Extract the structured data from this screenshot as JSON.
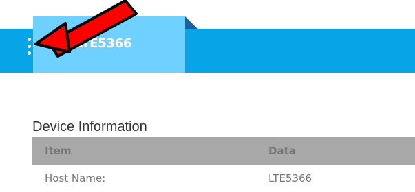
{
  "header": {
    "device_name": "LTE5366"
  },
  "section": {
    "title": "Device Information"
  },
  "table": {
    "columns": [
      "Item",
      "Data"
    ],
    "rows": [
      {
        "item": "Host Name:",
        "data": "LTE5366"
      }
    ]
  }
}
